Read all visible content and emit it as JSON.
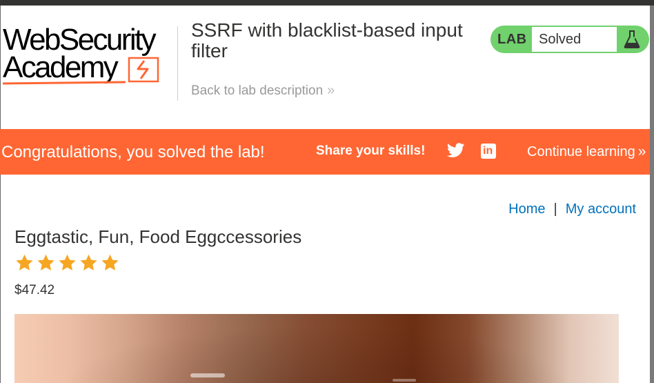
{
  "header": {
    "logo_line1": "WebSecurity",
    "logo_line2": "Academy",
    "lab_title": "SSRF with blacklist-based input filter",
    "back_link": "Back to lab description",
    "lab_tag": "LAB",
    "lab_status": "Solved"
  },
  "banner": {
    "congrats": "Congratulations, you solved the lab!",
    "share": "Share your skills!",
    "twitter_icon": "twitter-icon",
    "linkedin_icon": "linkedin-icon",
    "linkedin_letters": "in",
    "continue": "Continue learning"
  },
  "nav": {
    "home": "Home",
    "separator": "|",
    "my_account": "My account"
  },
  "product": {
    "title": "Eggtastic, Fun, Food Eggccessories",
    "rating": 5,
    "rating_max": 5,
    "price": "$47.42"
  },
  "colors": {
    "brand_orange": "#ff6633",
    "lab_green": "#70d16d",
    "link_blue": "#0071bc",
    "star_gold": "#f6a623"
  }
}
